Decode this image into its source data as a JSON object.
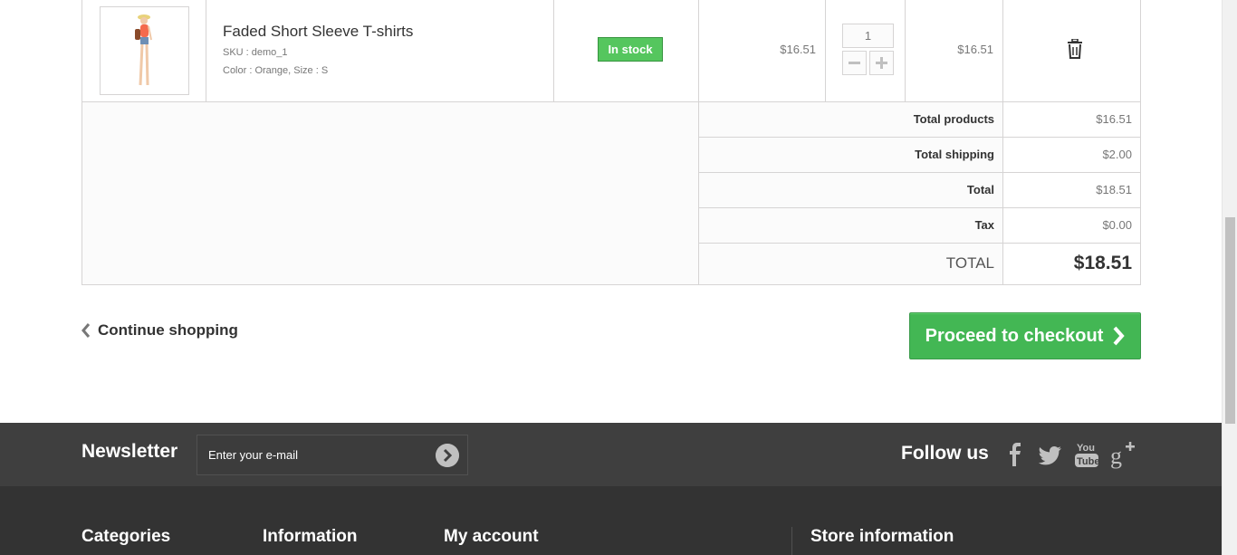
{
  "product": {
    "name": "Faded Short Sleeve T-shirts",
    "sku": "SKU : demo_1",
    "attributes": "Color : Orange, Size : S",
    "availability": "In stock",
    "unit_price": "$16.51",
    "quantity": "1",
    "line_total": "$16.51"
  },
  "summary": [
    {
      "label": "Total products",
      "value": "$16.51"
    },
    {
      "label": "Total shipping",
      "value": "$2.00"
    },
    {
      "label": "Total",
      "value": "$18.51"
    },
    {
      "label": "Tax",
      "value": "$0.00"
    }
  ],
  "grand_total": {
    "label": "TOTAL",
    "value": "$18.51"
  },
  "actions": {
    "continue_label": "Continue shopping",
    "checkout_label": "Proceed to checkout"
  },
  "newsletter": {
    "title": "Newsletter",
    "placeholder": "Enter your e-mail"
  },
  "follow": {
    "title": "Follow us"
  },
  "footer": {
    "categories": "Categories",
    "information": "Information",
    "my_account": "My account",
    "store_information": "Store information"
  },
  "colors": {
    "in_stock": "#55c65e",
    "checkout": "#43b754",
    "footer_bar": "#3f3f3f",
    "footer_main": "#333333"
  },
  "icons": [
    "chevron-left-icon",
    "chevron-right-icon",
    "trash-icon",
    "minus-icon",
    "plus-icon",
    "arrow-right-circle-icon",
    "facebook-icon",
    "twitter-icon",
    "youtube-icon",
    "google-plus-icon"
  ]
}
